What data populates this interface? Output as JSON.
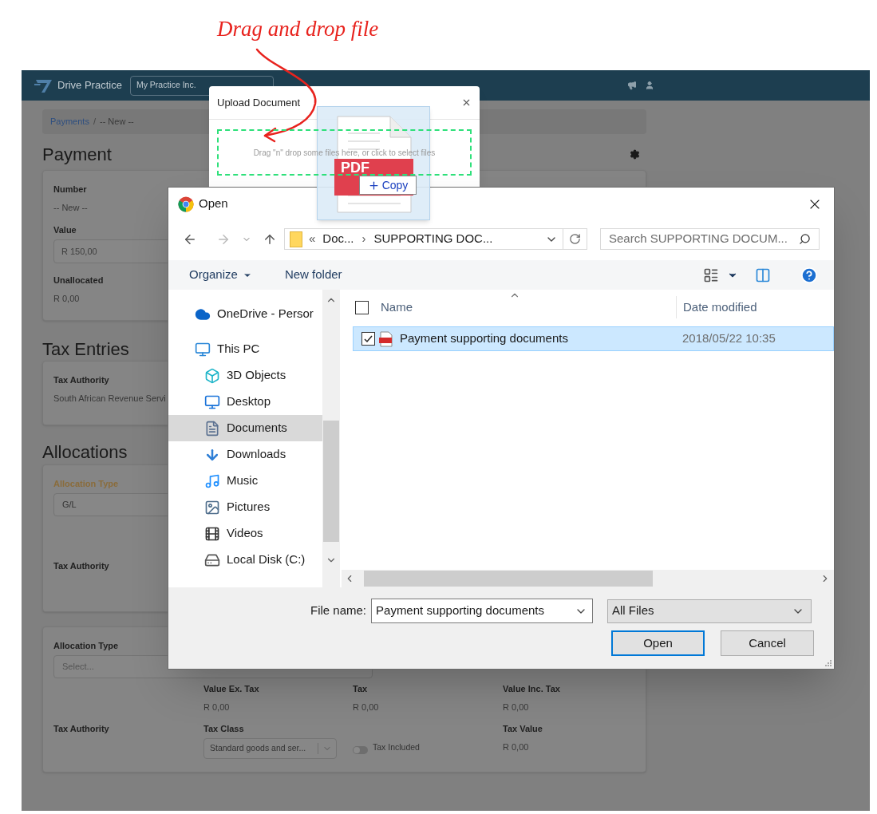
{
  "annotation": {
    "text": "Drag and drop file"
  },
  "app": {
    "brand": "Drive Practice",
    "practice": "My Practice Inc.",
    "breadcrumb": [
      {
        "label": "Payments",
        "kind": "link"
      },
      {
        "label": "/",
        "kind": "separator"
      },
      {
        "label": "-- New --",
        "kind": "current"
      }
    ],
    "payment": {
      "title": "Payment",
      "fields": [
        {
          "label": "Number",
          "value": "-- New --",
          "kind": "text"
        },
        {
          "label": "Value",
          "value": "R 150,00",
          "kind": "input"
        },
        {
          "label": "Unallocated",
          "value": "R 0,00",
          "kind": "text"
        }
      ]
    },
    "tax_entries": {
      "title": "Tax Entries",
      "label": "Tax Authority",
      "value": "South African Revenue Servi"
    },
    "allocations": {
      "title": "Allocations",
      "cards": [
        {
          "kind": "simple",
          "type_label": "Allocation Type",
          "type_active": true,
          "type_value": "G/L",
          "tax_authority_label": "Tax Authority"
        },
        {
          "kind": "detailed",
          "type_label": "Allocation Type",
          "type_active": false,
          "type_placeholder": "Select...",
          "tax_authority_label": "Tax Authority",
          "amounts": [
            {
              "label": "Value Ex. Tax",
              "value": "R 0,00"
            },
            {
              "label": "Tax",
              "value": "R 0,00"
            },
            {
              "label": "Value Inc. Tax",
              "value": "R 0,00"
            }
          ],
          "tax_class": {
            "label": "Tax Class",
            "value": "Standard goods and ser..."
          },
          "tax_included": {
            "label": "Tax Included",
            "on": false
          },
          "tax_value": {
            "label": "Tax Value",
            "value": "R 0,00"
          }
        }
      ]
    }
  },
  "upload_modal": {
    "title": "Upload Document",
    "dropzone": "Drag \"n\" drop some files here, or click to select files"
  },
  "drag_ghost": {
    "file_label": "PDF",
    "badge": "Copy"
  },
  "open_dialog": {
    "title": "Open",
    "path": [
      "«",
      "Doc...",
      "›",
      "SUPPORTING DOC..."
    ],
    "search_placeholder": "Search SUPPORTING DOCUM...",
    "toolbar": {
      "organize": "Organize",
      "new_folder": "New folder"
    },
    "nav": [
      {
        "label": "OneDrive - Persor",
        "selected": false
      },
      {
        "label": "This PC",
        "selected": false,
        "children": [
          {
            "label": "3D Objects",
            "selected": false
          },
          {
            "label": "Desktop",
            "selected": false
          },
          {
            "label": "Documents",
            "selected": true
          },
          {
            "label": "Downloads",
            "selected": false
          },
          {
            "label": "Music",
            "selected": false
          },
          {
            "label": "Pictures",
            "selected": false
          },
          {
            "label": "Videos",
            "selected": false
          },
          {
            "label": "Local Disk (C:)",
            "selected": false
          }
        ]
      }
    ],
    "columns": [
      "Name",
      "Date modified"
    ],
    "select_all_checked": false,
    "files": [
      {
        "name": "Payment supporting documents",
        "date": "2018/05/22 10:35",
        "selected": true,
        "checked": true
      }
    ],
    "file_name_label": "File name:",
    "file_name": "Payment supporting documents",
    "filter": "All Files",
    "buttons": [
      {
        "label": "Open",
        "default": true
      },
      {
        "label": "Cancel",
        "default": false
      }
    ]
  }
}
